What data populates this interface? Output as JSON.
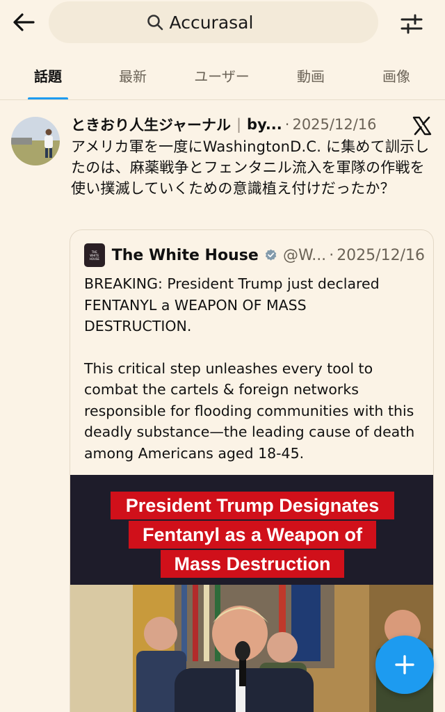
{
  "header": {
    "search_query": "Accurasal"
  },
  "tabs": [
    {
      "label": "話題",
      "active": true
    },
    {
      "label": "最新",
      "active": false
    },
    {
      "label": "ユーザー",
      "active": false
    },
    {
      "label": "動画",
      "active": false
    },
    {
      "label": "画像",
      "active": false
    }
  ],
  "post": {
    "author_name": "ときおり人生ジャーナル",
    "separator": "|",
    "author_handle": "by...",
    "dot": "·",
    "date": "2025/12/16",
    "text": "アメリカ軍を一度にWashingtonD.C. に集めて訓示したのは、麻薬戦争とフェンタニル流入を軍隊の作戦を使い撲滅していくための意識植え付けだったか？",
    "platform_icon": "x-logo-icon"
  },
  "quote": {
    "logo_text": "THE WHITE HOUSE",
    "name": "The White House",
    "handle": "@W...",
    "dot": "·",
    "date": "2025/12/16",
    "paragraph1": "BREAKING: President Trump just declared FENTANYL a WEAPON OF MASS DESTRUCTION.",
    "paragraph2": "This critical step unleashes every tool to combat the cartels & foreign networks responsible for flooding communities with this deadly substance—the leading cause of death among Americans aged 18-45.",
    "media": {
      "banner_line1": "President Trump Designates",
      "banner_line2": "Fentanyl as a Weapon of",
      "banner_line3": "Mass Destruction"
    }
  },
  "colors": {
    "accent": "#1d9bf0",
    "background": "#fbf3e6",
    "banner_red": "#d0101a"
  }
}
